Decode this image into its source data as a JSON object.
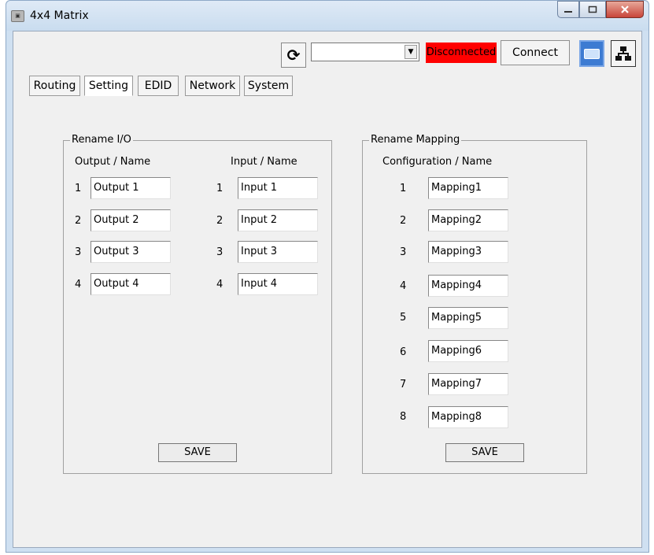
{
  "window": {
    "title": "4x4 Matrix",
    "icon": "matrix-app-icon"
  },
  "toolbar": {
    "refresh_glyph": "⟳",
    "port_value": "",
    "status": "Disconnected",
    "status_color": "#ff0000",
    "connect_label": "Connect"
  },
  "tabs": [
    "Routing",
    "Setting",
    "EDID",
    "Network",
    "System"
  ],
  "rename_io": {
    "title": "Rename I/O",
    "output_header": "Output  /  Name",
    "input_header": "Input  /  Name",
    "outputs": [
      {
        "num": "1",
        "value": "Output 1"
      },
      {
        "num": "2",
        "value": "Output 2"
      },
      {
        "num": "3",
        "value": "Output 3"
      },
      {
        "num": "4",
        "value": "Output 4"
      }
    ],
    "inputs": [
      {
        "num": "1",
        "value": "Input 1"
      },
      {
        "num": "2",
        "value": "Input 2"
      },
      {
        "num": "3",
        "value": "Input 3"
      },
      {
        "num": "4",
        "value": "Input 4"
      }
    ],
    "save_label": "SAVE"
  },
  "rename_mapping": {
    "title": "Rename Mapping",
    "header": "Configuration / Name",
    "mappings": [
      {
        "num": "1",
        "value": "Mapping1"
      },
      {
        "num": "2",
        "value": "Mapping2"
      },
      {
        "num": "3",
        "value": "Mapping3"
      },
      {
        "num": "4",
        "value": "Mapping4"
      },
      {
        "num": "5",
        "value": "Mapping5"
      },
      {
        "num": "6",
        "value": "Mapping6"
      },
      {
        "num": "7",
        "value": "Mapping7"
      },
      {
        "num": "8",
        "value": "Mapping8"
      }
    ],
    "save_label": "SAVE"
  }
}
